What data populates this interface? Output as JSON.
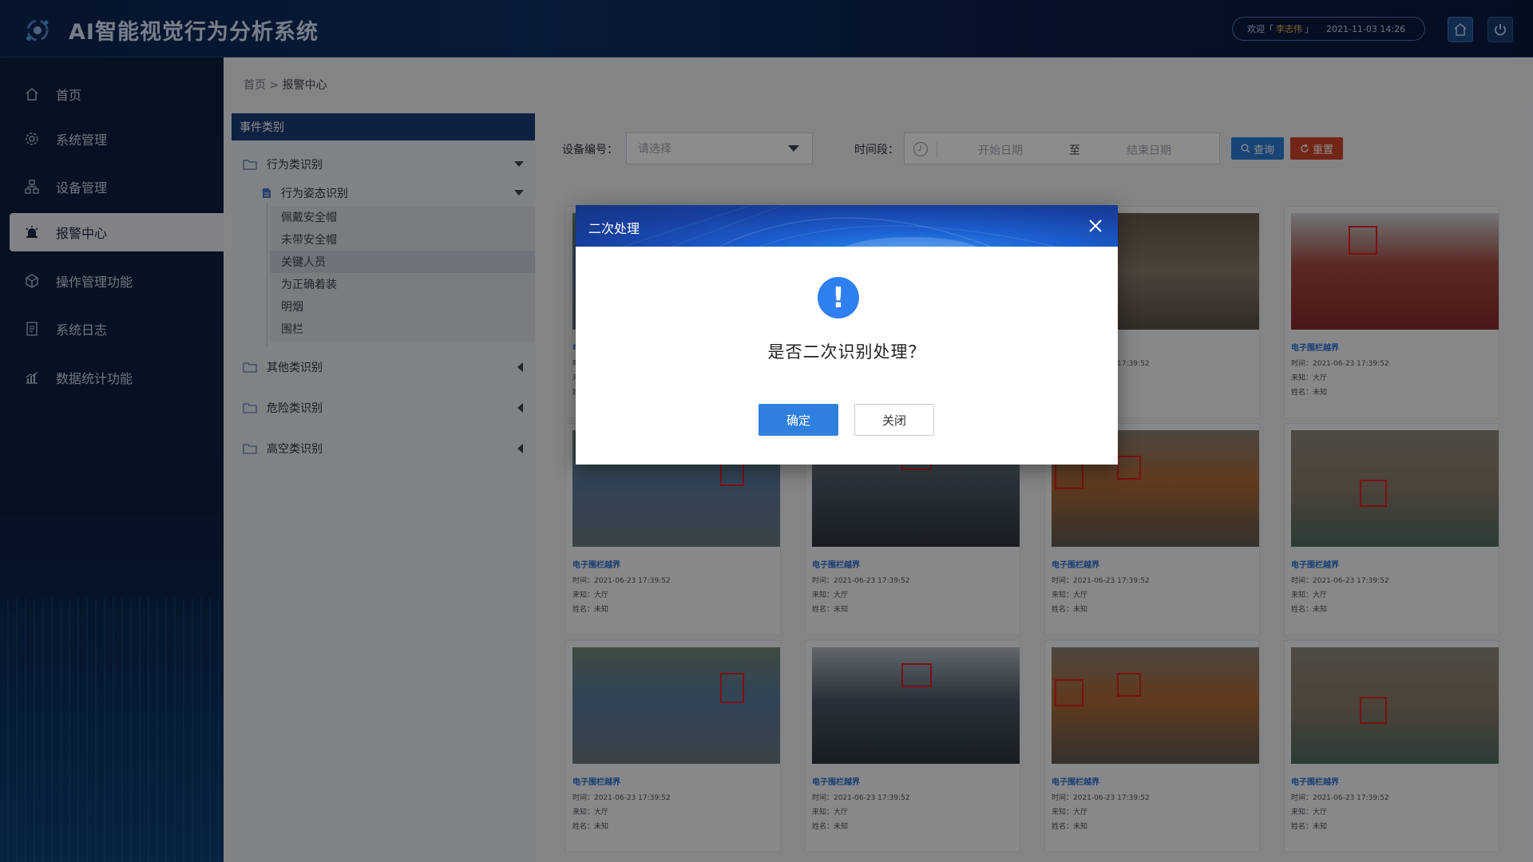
{
  "app": {
    "title": "AI智能视觉行为分析系统"
  },
  "header": {
    "welcome_prefix": "欢迎「",
    "user_name": "李志伟",
    "welcome_suffix": "」",
    "datetime": "2021-11-03  14:26"
  },
  "sidebar": {
    "items": [
      {
        "label": "首页",
        "icon": "home-icon"
      },
      {
        "label": "系统管理",
        "icon": "gear-icon"
      },
      {
        "label": "设备管理",
        "icon": "network-icon"
      },
      {
        "label": "报警中心",
        "icon": "alarm-icon",
        "active": true
      },
      {
        "label": "操作管理功能",
        "icon": "cube-icon"
      },
      {
        "label": "系统日志",
        "icon": "log-icon"
      },
      {
        "label": "数据统计功能",
        "icon": "chart-icon"
      }
    ]
  },
  "breadcrumb": {
    "home": "首页",
    "sep": ">",
    "current": "报警中心"
  },
  "tree": {
    "header": "事件类别",
    "group1": "行为类识别",
    "subgroup": "行为姿态识别",
    "leaves": [
      "佩戴安全帽",
      "未带安全帽",
      "关键人员",
      "为正确着装",
      "明烟",
      "围栏"
    ],
    "selected_leaf": "关键人员",
    "group2": "其他类识别",
    "group3": "危险类识别",
    "group4": "高空类识别"
  },
  "filters": {
    "device_label": "设备编号：",
    "device_placeholder": "请选择",
    "time_label": "时间段：",
    "start_placeholder": "开始日期",
    "to": "至",
    "end_placeholder": "结束日期",
    "query": "查询",
    "reset": "重置"
  },
  "card_text": {
    "title": "电子围栏越界",
    "time": "时间：2021-06-23  17:39:52",
    "place": "来知：大厅",
    "name": "姓名：未知"
  },
  "colors": {
    "brand_blue": "#2e7fde",
    "danger": "#d2452c",
    "header_bg": "#0f3269",
    "detect_box": "#e02020"
  },
  "modal": {
    "title": "二次处理",
    "message": "是否二次识别处理？",
    "ok": "确定",
    "close": "关闭"
  }
}
